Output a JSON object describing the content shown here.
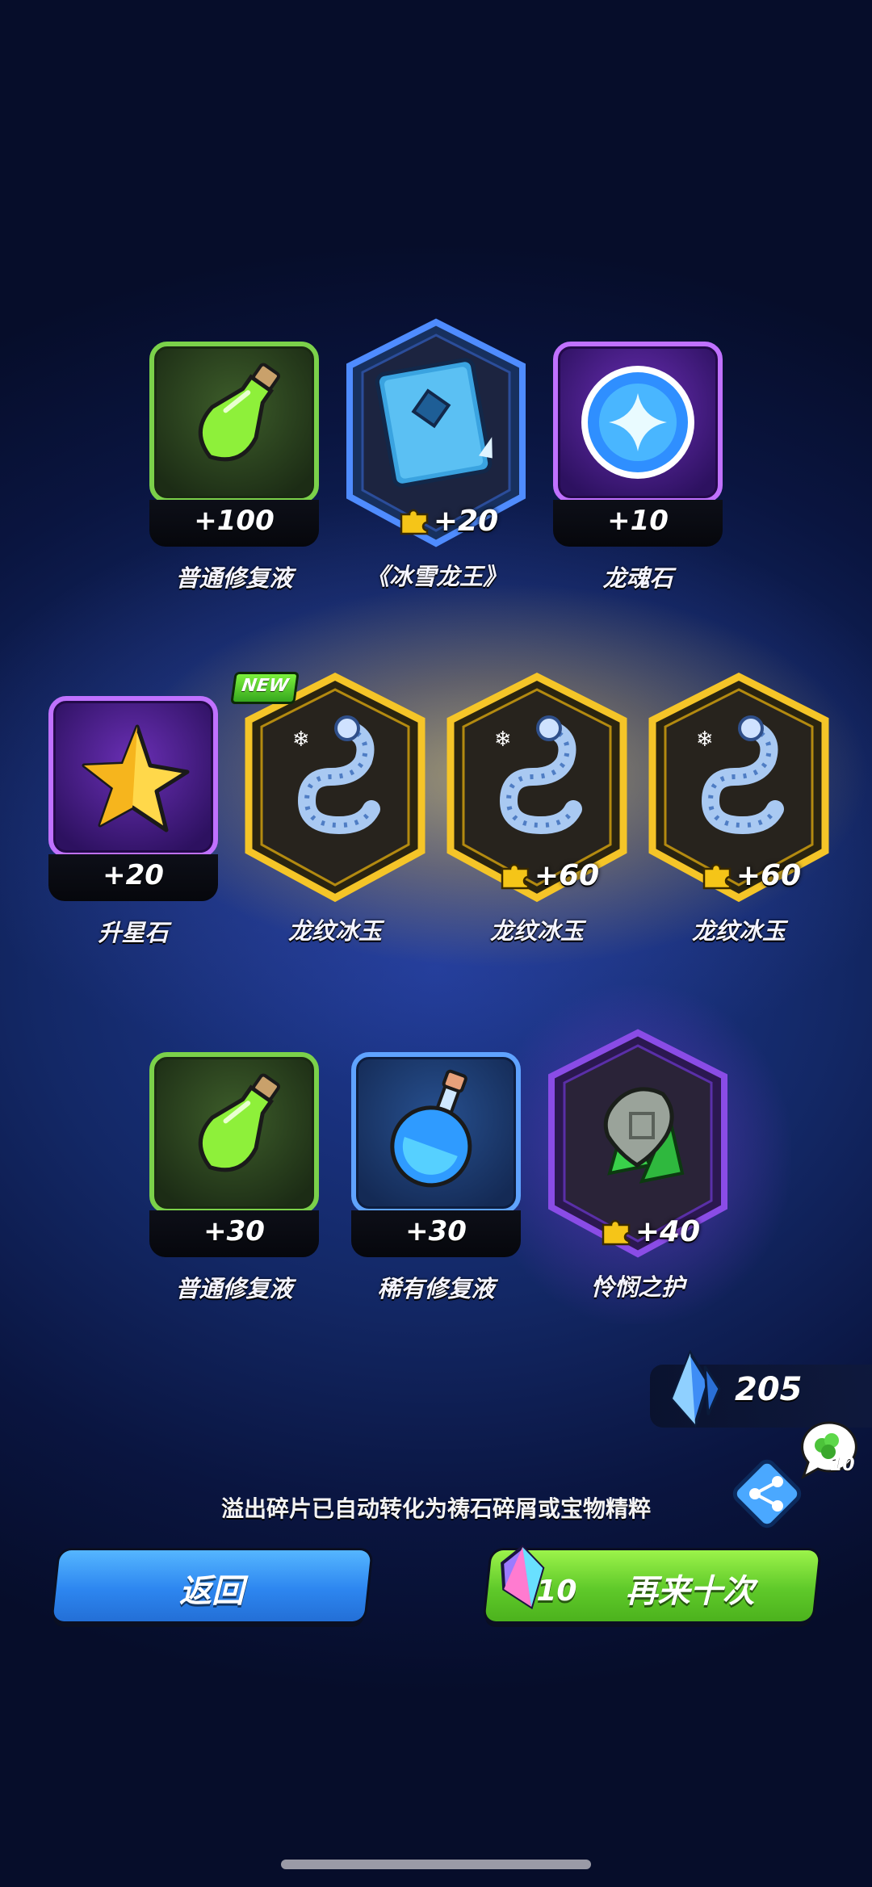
{
  "rows": [
    [
      {
        "name": "普通修复液",
        "qty": "+100",
        "frame": "green",
        "icon": "green-potion-icon",
        "shape": "square"
      },
      {
        "name": "《冰雪龙王》",
        "qty": "+20",
        "frame": "blue-hex",
        "icon": "ice-dragon-book-icon",
        "shape": "hex",
        "fragment": true
      },
      {
        "name": "龙魂石",
        "qty": "+10",
        "frame": "purple",
        "icon": "dragon-soul-orb-icon",
        "shape": "square"
      }
    ],
    [
      {
        "name": "升星石",
        "qty": "+20",
        "frame": "purple",
        "icon": "star-stone-icon",
        "shape": "square"
      },
      {
        "name": "龙纹冰玉",
        "qty": "",
        "frame": "gold-hex",
        "icon": "ice-dragon-jade-icon",
        "shape": "hex",
        "new": true
      },
      {
        "name": "龙纹冰玉",
        "qty": "+60",
        "frame": "gold-hex",
        "icon": "ice-dragon-jade-icon",
        "shape": "hex",
        "fragment": true
      },
      {
        "name": "龙纹冰玉",
        "qty": "+60",
        "frame": "gold-hex",
        "icon": "ice-dragon-jade-icon",
        "shape": "hex",
        "fragment": true
      }
    ],
    [
      {
        "name": "普通修复液",
        "qty": "+30",
        "frame": "green",
        "icon": "green-potion-icon",
        "shape": "square"
      },
      {
        "name": "稀有修复液",
        "qty": "+30",
        "frame": "blue",
        "icon": "blue-potion-icon",
        "shape": "square"
      },
      {
        "name": "怜悯之护",
        "qty": "+40",
        "frame": "purple-hex",
        "icon": "mercy-shield-icon",
        "shape": "hex",
        "fragment": true
      }
    ]
  ],
  "new_label": "NEW",
  "currency": {
    "value": "205",
    "icon": "crystal-icon"
  },
  "share": {
    "icon": "share-icon",
    "bubble_icon": "clover-bubble-icon",
    "bubble_count": "10"
  },
  "notice": "溢出碎片已自动转化为祷石碎屑或宝物精粹",
  "buttons": {
    "back": "返回",
    "again": "再来十次",
    "again_cost": "10",
    "again_cost_icon": "rainbow-crystal-icon"
  },
  "colors": {
    "green_frame": "#7bd14a",
    "purple_frame": "#c071ff",
    "blue_frame": "#5fa3ff",
    "gold_frame": "#f5c528",
    "back_button": "#2d86f0",
    "again_button": "#5fc92a"
  }
}
